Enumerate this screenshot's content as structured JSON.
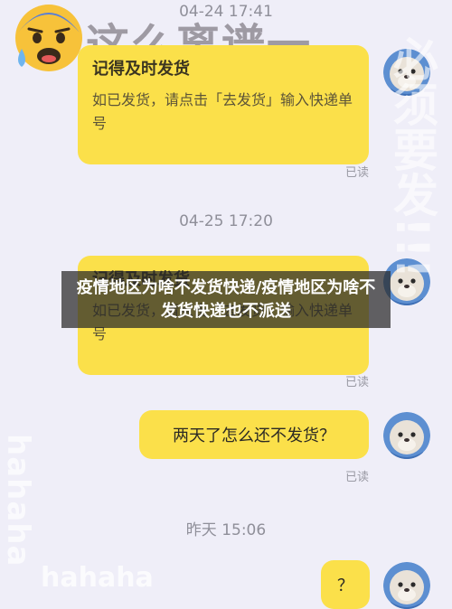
{
  "watermark": {
    "top_text": "这么离谱一",
    "right_text": "必须要发!!!",
    "left_text": "hahaha",
    "bottom_text": "hahaha"
  },
  "banner": {
    "text": "疫情地区为啥不发货快递/疫情地区为啥不发货快递也不派送"
  },
  "messages": [
    {
      "timestamp": "04-24 17:41",
      "title": "记得及时发货",
      "body": "如已发货，请点击「去发货」输入快递单号",
      "status": "已读"
    },
    {
      "timestamp": "04-25 17:20",
      "title": "记得及时发货",
      "body": "如已发货，请点击「去发货」输入快递单号",
      "status": "已读"
    },
    {
      "text": "两天了怎么还不发货？",
      "status": "已读"
    },
    {
      "timestamp": "昨天 15:06",
      "text": "？"
    }
  ],
  "colors": {
    "bubble": "#fbe04a",
    "background": "#efeef8",
    "banner": "#282828"
  },
  "icons": {
    "sticker": "anxious-sweat-emoji-icon",
    "avatar": "seal-avatar-icon"
  }
}
